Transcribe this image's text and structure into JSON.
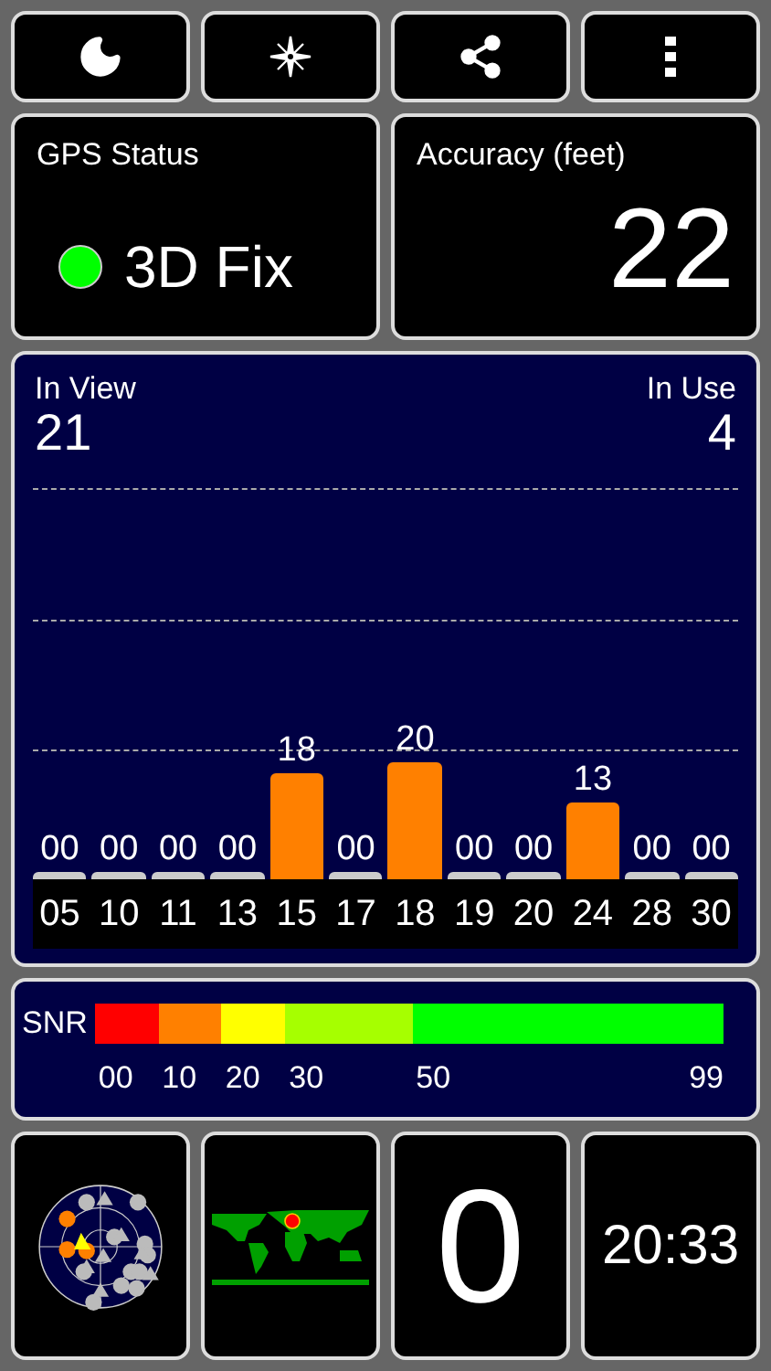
{
  "toolbar": [
    {
      "kind": "night"
    },
    {
      "kind": "compass"
    },
    {
      "kind": "share"
    },
    {
      "kind": "more"
    }
  ],
  "gps_status": {
    "title": "GPS Status",
    "value": "3D Fix",
    "color": "#00ff00"
  },
  "accuracy": {
    "title": "Accuracy (feet)",
    "value": "22"
  },
  "satellites": {
    "in_view_label": "In View",
    "in_view": "21",
    "in_use_label": "In Use",
    "in_use": "4",
    "chart_data": {
      "type": "bar",
      "categories": [
        "05",
        "10",
        "11",
        "13",
        "15",
        "17",
        "18",
        "19",
        "20",
        "24",
        "28",
        "30"
      ],
      "values": [
        0,
        0,
        0,
        0,
        18,
        0,
        20,
        0,
        0,
        13,
        0,
        0
      ],
      "value_labels": [
        "00",
        "00",
        "00",
        "00",
        "18",
        "00",
        "20",
        "00",
        "00",
        "13",
        "00",
        "00"
      ]
    }
  },
  "snr": {
    "label": "SNR",
    "segments": [
      {
        "label": "00",
        "color": "#ff0000"
      },
      {
        "label": "10",
        "color": "#ff8000"
      },
      {
        "label": "20",
        "color": "#ffff00"
      },
      {
        "label": "30",
        "color": "#a6ff00"
      },
      {
        "label": "50",
        "color": "#00ff00"
      }
    ],
    "end_label": "99"
  },
  "bottom": {
    "count": "0",
    "time": "20:33"
  }
}
